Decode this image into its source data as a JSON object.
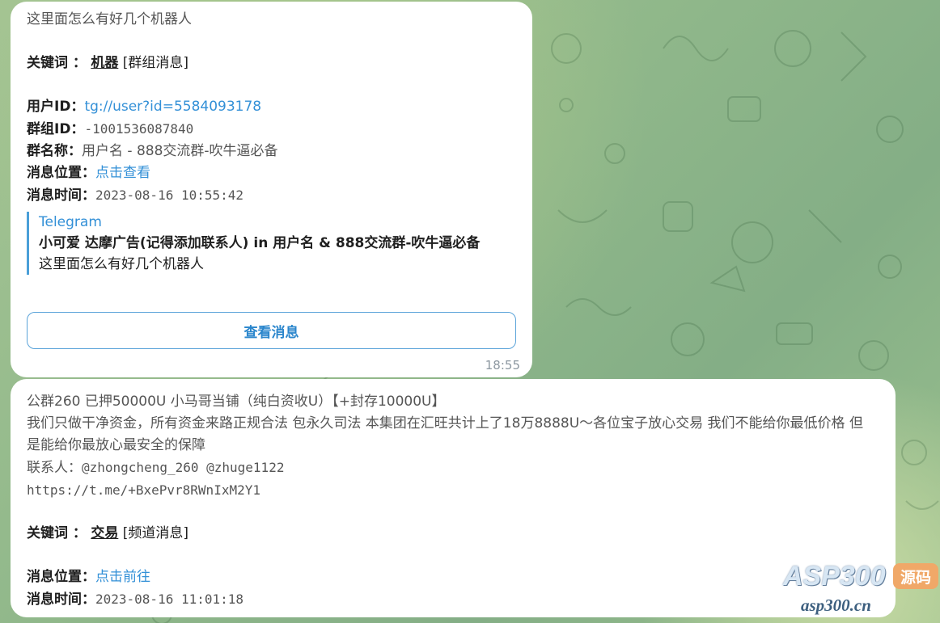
{
  "msg1": {
    "text": "这里面怎么有好几个机器人",
    "keyword_label": "关键词 ：",
    "keyword": "机器",
    "keyword_tag": "[群组消息]",
    "user_id_label": "用户ID：",
    "user_id_link": "tg://user?id=5584093178",
    "group_id_label": "群组ID：",
    "group_id": "-1001536087840",
    "group_name_label": "群名称：",
    "group_name": "用户名 - 888交流群-吹牛逼必备",
    "position_label": "消息位置：",
    "position_link": "点击查看",
    "time_label": "消息时间：",
    "time_value": "2023-08-16 10:55:42",
    "quote": {
      "source": "Telegram",
      "title": "小可爱 达摩广告(记得添加联系人) in 用户名 & 888交流群-吹牛逼必备",
      "text": "这里面怎么有好几个机器人"
    },
    "button": "查看消息",
    "timestamp": "18:55"
  },
  "msg2": {
    "line1": "公群260 已押50000U 小马哥当铺（纯白资收U）【+封存10000U】",
    "line2": "我们只做干净资金，所有资金来路正规合法 包永久司法 本集团在汇旺共计上了18万8888U～各位宝子放心交易 我们不能给你最低价格 但是能给你最放心最安全的保障",
    "contact_label": "联系人：",
    "contacts": "@zhongcheng_260 @zhuge1122",
    "invite_link": "https://t.me/+BxePvr8RWnIxM2Y1",
    "keyword_label": "关键词 ：",
    "keyword": "交易",
    "keyword_tag": "[频道消息]",
    "position_label": "消息位置：",
    "position_link": "点击前往",
    "time_label": "消息时间：",
    "time_value": "2023-08-16 11:01:18"
  },
  "watermark": {
    "brand": "ASP300",
    "tag": "源码",
    "domain": "asp300.cn"
  }
}
